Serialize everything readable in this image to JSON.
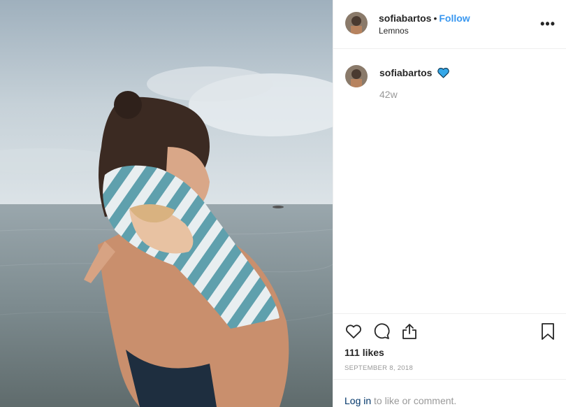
{
  "post": {
    "username": "sofiabartos",
    "dot": "•",
    "follow_label": "Follow",
    "location": "Lemnos",
    "more_label": "•••"
  },
  "caption": {
    "username": "sofiabartos",
    "emoji": "blue-heart-icon",
    "time_ago": "42w"
  },
  "actions": {
    "icons": [
      "heart-icon",
      "comment-icon",
      "share-icon",
      "bookmark-icon"
    ],
    "likes": "111 likes",
    "date": "SEPTEMBER 8, 2018"
  },
  "footer": {
    "login_label": "Log in",
    "rest_label": " to like or comment."
  },
  "colors": {
    "follow": "#3897f0",
    "heart_emoji": "#35a7e8",
    "link": "#003569",
    "muted": "#999999"
  }
}
